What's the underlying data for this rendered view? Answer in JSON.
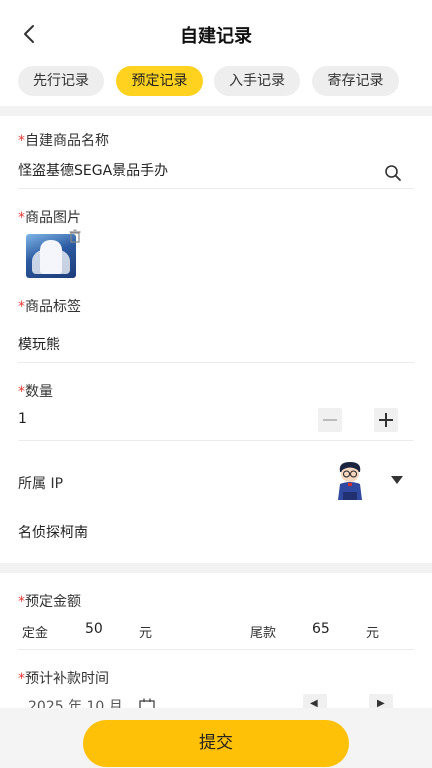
{
  "header": {
    "title": "自建记录"
  },
  "tabs": [
    {
      "label": "先行记录",
      "active": false
    },
    {
      "label": "预定记录",
      "active": true
    },
    {
      "label": "入手记录",
      "active": false
    },
    {
      "label": "寄存记录",
      "active": false
    }
  ],
  "form": {
    "name": {
      "label": "自建商品名称",
      "required_mark": "*",
      "value": "怪盗基德SEGA景品手办"
    },
    "image": {
      "label": "商品图片",
      "required_mark": "*"
    },
    "tag": {
      "label": "商品标签",
      "required_mark": "*",
      "value": "模玩熊"
    },
    "quantity": {
      "label": "数量",
      "required_mark": "*",
      "value": "1"
    },
    "ip": {
      "label": "所属 IP",
      "value": "名侦探柯南"
    },
    "deposit": {
      "label": "预定金额",
      "required_mark": "*",
      "deposit_label": "定金",
      "deposit_value": "50",
      "deposit_unit": "元",
      "balance_label": "尾款",
      "balance_value": "65",
      "balance_unit": "元"
    },
    "payment_time": {
      "label": "预计补款时间",
      "required_mark": "*",
      "value": "2025 年 10 月"
    }
  },
  "submit_label": "提交",
  "colors": {
    "accent": "#ffc107",
    "active_tab": "#ffd21f",
    "required": "#e53935"
  }
}
